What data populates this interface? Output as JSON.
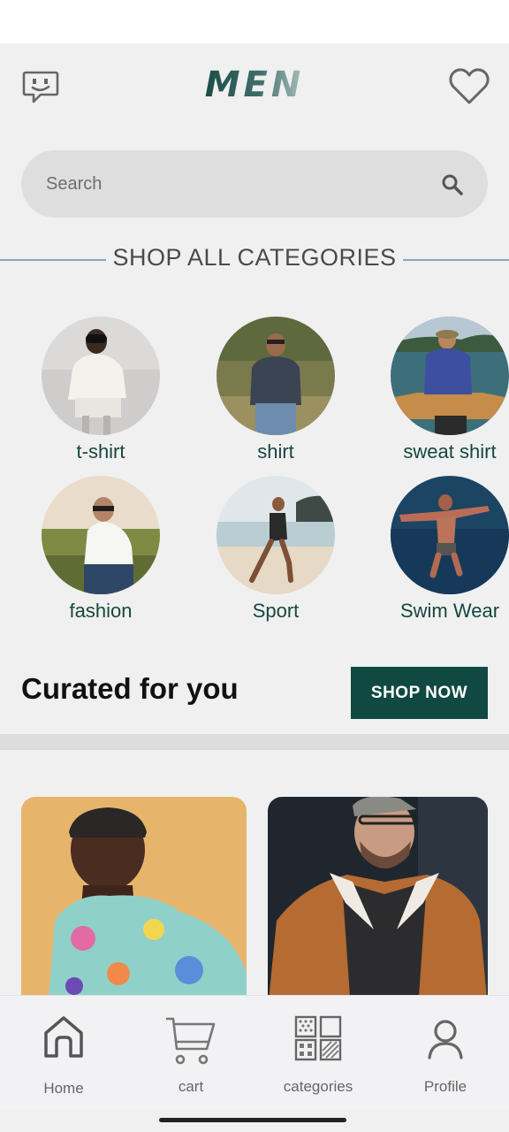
{
  "header": {
    "logo_text": "MEN",
    "chat_icon": "chat-smiley-icon",
    "heart_icon": "heart-icon"
  },
  "search": {
    "placeholder": "Search",
    "icon": "search-icon"
  },
  "categories_section": {
    "title": "SHOP ALL CATEGORIES",
    "items": [
      {
        "label": "t-shirt"
      },
      {
        "label": "shirt"
      },
      {
        "label": "sweat shirt"
      },
      {
        "label": "fashion"
      },
      {
        "label": "Sport"
      },
      {
        "label": "Swim Wear"
      }
    ]
  },
  "curated": {
    "title": "Curated for you",
    "button_label": "SHOP NOW"
  },
  "bottom_nav": {
    "items": [
      {
        "label": "Home",
        "icon": "home-icon"
      },
      {
        "label": "cart",
        "icon": "cart-icon"
      },
      {
        "label": "categories",
        "icon": "categories-icon"
      },
      {
        "label": "Profile",
        "icon": "profile-icon"
      }
    ]
  },
  "colors": {
    "brand": "#104941",
    "background": "#f0f0f0",
    "category_label": "#16473f"
  }
}
